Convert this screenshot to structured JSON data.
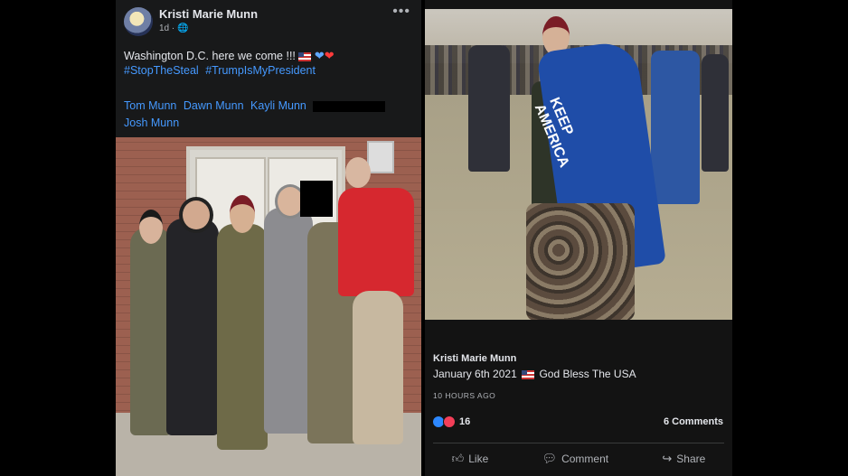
{
  "left_post": {
    "author": "Kristi Marie Munn",
    "time": "1d",
    "privacy_icon": "public-globe-icon",
    "message": "Washington D.C. here we come !!!",
    "hashtags": [
      "#StopTheSteal",
      "#TrumpIsMyPresident"
    ],
    "tagged_people": [
      "Tom Munn",
      "Dawn Munn",
      "Kayli Munn",
      "Josh Munn"
    ]
  },
  "right_post": {
    "author": "Kristi Marie Munn",
    "caption_date": "January 6th 2021",
    "caption_text": "God Bless The USA",
    "time_ago": "10 HOURS AGO",
    "reaction_count": "16",
    "comments": "6 Comments",
    "actions": {
      "like": "Like",
      "comment": "Comment",
      "share": "Share"
    },
    "flag_text": "KEEP AMERICA"
  },
  "colors": {
    "link": "#4599ff",
    "background": "#18191a",
    "like": "#2d88ff",
    "love": "#f33e58"
  }
}
